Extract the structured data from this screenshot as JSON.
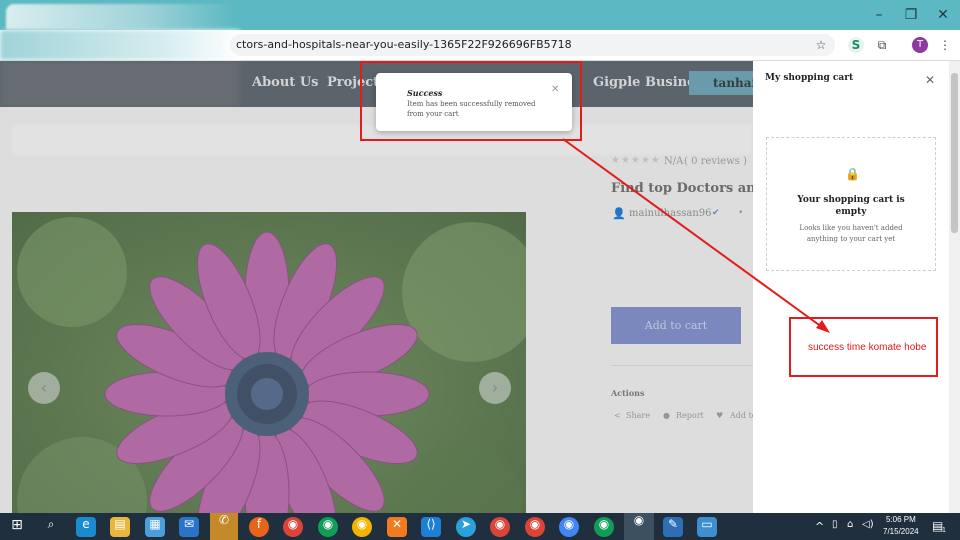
{
  "browser": {
    "url": "ctors-and-hospitals-near-you-easily-1365F22F926696FB5718",
    "profile_initial": "T",
    "window_controls": [
      "minimize",
      "restore",
      "close"
    ]
  },
  "nav": {
    "links": [
      "About Us",
      "Projects",
      "Gigple Business"
    ],
    "account_button": "tanhais"
  },
  "product": {
    "rating_text": "N/A",
    "reviews_text": "( 0 reviews )",
    "title": "Find top Doctors and Ho",
    "seller": "mainulhassan96",
    "add_to_cart": "Add to cart",
    "actions_label": "Actions",
    "actions": [
      "Share",
      "Report",
      "Add to"
    ]
  },
  "toast": {
    "title": "Success",
    "message_line1": "Item has been successfully removed",
    "message_line2": "from your cart"
  },
  "cart": {
    "title": "My shopping cart",
    "empty_title_line1": "Your shopping cart is",
    "empty_title_line2": "empty",
    "empty_desc_line1": "Looks like you haven't added",
    "empty_desc_line2": "anything to your cart yet"
  },
  "annotation": {
    "note": "success time komate hobe",
    "color": "#e21b1b"
  },
  "taskbar": {
    "time": "5:06 PM",
    "date": "7/15/2024",
    "notification_count": "1"
  }
}
